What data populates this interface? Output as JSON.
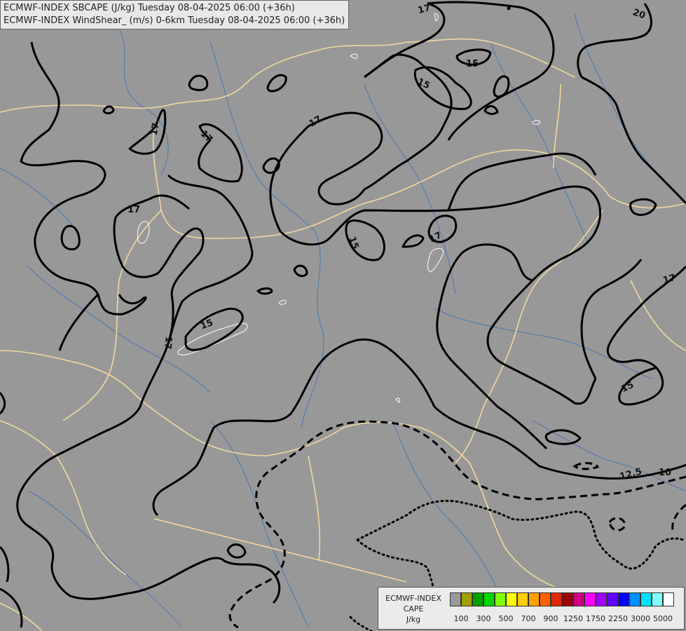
{
  "title": {
    "line1": "ECMWF-INDEX SBCAPE (J/kg) Tuesday 08-04-2025 06:00 (+36h)",
    "line2": "ECMWF-INDEX WindShear_ (m/s) 0-6km Tuesday 08-04-2025 06:00 (+36h)"
  },
  "contour_labels": [
    "17",
    "20",
    "15",
    "15",
    "17",
    "17",
    "17",
    "15",
    "17",
    "15",
    "17",
    "17",
    "17",
    "15",
    "12.5",
    "10"
  ],
  "legend": {
    "title_line1": "ECMWF-INDEX",
    "title_line2": "CAPE",
    "title_line3": "J/kg",
    "colors": [
      "#9a9a9a",
      "#a0a000",
      "#00a000",
      "#00d800",
      "#80ff00",
      "#ffff00",
      "#ffd000",
      "#ffa000",
      "#ff6000",
      "#e02800",
      "#a00000",
      "#d00080",
      "#ff00ff",
      "#a000ff",
      "#6000ff",
      "#0000ff",
      "#0090ff",
      "#00e0ff",
      "#80ffff",
      "#ffffff"
    ],
    "ticks": [
      "100",
      "300",
      "500",
      "700",
      "900",
      "1250",
      "1750",
      "2250",
      "3000",
      "5000"
    ]
  },
  "colors": {
    "background": "#989898",
    "borders": "#f0d8a0",
    "rivers": "#4a78b0",
    "contours": "#000000"
  }
}
